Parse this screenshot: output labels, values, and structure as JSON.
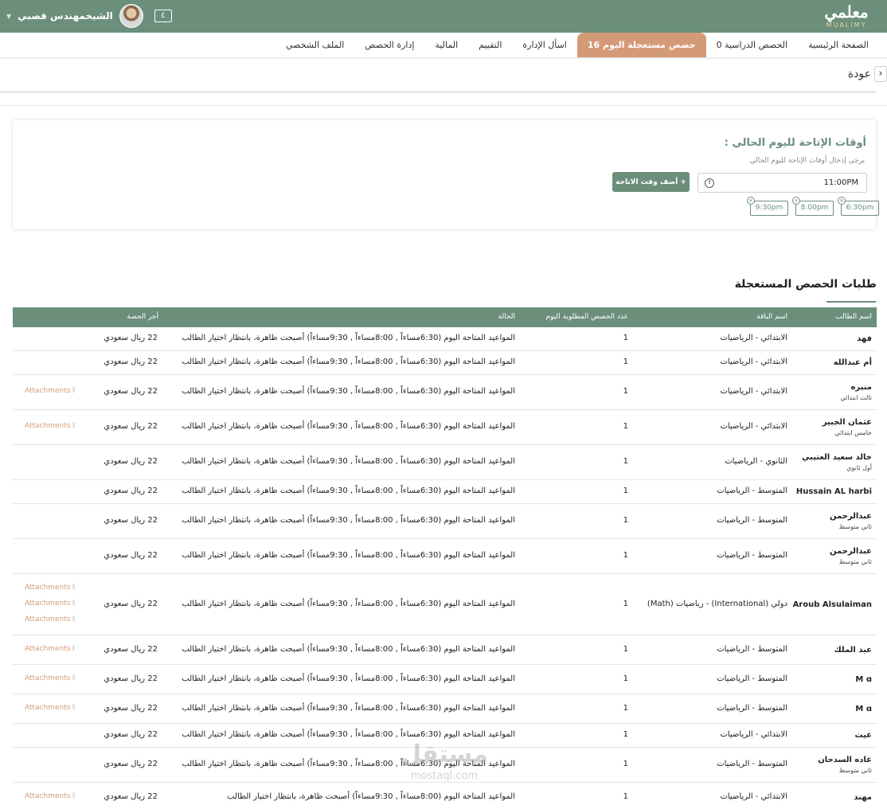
{
  "header": {
    "logo_ar": "معلمي",
    "logo_en": "MUALIMY",
    "user_name": "الشيخمهندس قصبي",
    "notifications": "٤"
  },
  "nav": {
    "tabs": [
      {
        "label": "الصفحة الرئيسية",
        "active": false
      },
      {
        "label": "الحصص الدراسية 0",
        "active": false
      },
      {
        "label": "حصص مستعجلة اليوم 16",
        "active": true
      },
      {
        "label": "اسأل الإدارة",
        "active": false
      },
      {
        "label": "التقييم",
        "active": false
      },
      {
        "label": "المالية",
        "active": false
      },
      {
        "label": "إدارة الحصص",
        "active": false
      },
      {
        "label": "الملف الشخصي",
        "active": false
      }
    ]
  },
  "back": {
    "label": "عودة"
  },
  "availability": {
    "title": "أوقات الإتاحة لليوم الحالي :",
    "subtitle": "يرجى إدخال أوقات الإتاحة لليوم الحالي",
    "time_value": "11:00PM",
    "add_button": "أضف وقت الاتاحة",
    "add_plus": "+",
    "chips": [
      "6:30pm",
      "8:00pm",
      "9:30pm"
    ]
  },
  "requests": {
    "title": "طلبات الحصص المستعجلة",
    "columns": {
      "student": "اسم الطالب",
      "package": "اسم الباقة",
      "count": "عدد الحصص المطلوبة اليوم",
      "status": "الحالة",
      "fee": "أجر الحصة"
    },
    "attachment_label": "Attachments",
    "rows": [
      {
        "name": "فهد",
        "grade": "",
        "package": "الابتدائي - الرياضيات",
        "count": "1",
        "status": "المواعيد المتاحة اليوم (6:30مساءاً , 8:00مساءاً , 9:30مساءاً) أصبحت ظاهرة، بانتظار اختيار الطالب",
        "fee": "22 ريال سعودي",
        "attachments": 0
      },
      {
        "name": "أم عبدالله",
        "grade": "",
        "package": "الابتدائي - الرياضيات",
        "count": "1",
        "status": "المواعيد المتاحة اليوم (6:30مساءاً , 8:00مساءاً , 9:30مساءاً) أصبحت ظاهرة، بانتظار اختيار الطالب",
        "fee": "22 ريال سعودي",
        "attachments": 0
      },
      {
        "name": "منيره",
        "grade": "ثالث ابتدائي",
        "package": "الابتدائي - الرياضيات",
        "count": "1",
        "status": "المواعيد المتاحة اليوم (6:30مساءاً , 8:00مساءاً , 9:30مساءاً) أصبحت ظاهرة، بانتظار اختيار الطالب",
        "fee": "22 ريال سعودي",
        "attachments": 1
      },
      {
        "name": "عثمان الجبير",
        "grade": "خامس ابتدائي",
        "package": "الابتدائي - الرياضيات",
        "count": "1",
        "status": "المواعيد المتاحة اليوم (6:30مساءاً , 8:00مساءاً , 9:30مساءاً) أصبحت ظاهرة، بانتظار اختيار الطالب",
        "fee": "22 ريال سعودي",
        "attachments": 1
      },
      {
        "name": "خالد سعيد العتيبي",
        "grade": "أول ثانوي",
        "package": "الثانوي - الرياضيات",
        "count": "1",
        "status": "المواعيد المتاحة اليوم (6:30مساءاً , 8:00مساءاً , 9:30مساءاً) أصبحت ظاهرة، بانتظار اختيار الطالب",
        "fee": "22 ريال سعودي",
        "attachments": 0
      },
      {
        "name": "Hussain AL harbi",
        "grade": "",
        "package": "المتوسط - الرياضيات",
        "count": "1",
        "status": "المواعيد المتاحة اليوم (6:30مساءاً , 8:00مساءاً , 9:30مساءاً) أصبحت ظاهرة، بانتظار اختيار الطالب",
        "fee": "22 ريال سعودي",
        "attachments": 0
      },
      {
        "name": "عبدالرحمن",
        "grade": "ثاني متوسط",
        "package": "المتوسط - الرياضيات",
        "count": "1",
        "status": "المواعيد المتاحة اليوم (6:30مساءاً , 8:00مساءاً , 9:30مساءاً) أصبحت ظاهرة، بانتظار اختيار الطالب",
        "fee": "22 ريال سعودي",
        "attachments": 0
      },
      {
        "name": "عبدالرحمن",
        "grade": "ثاني متوسط",
        "package": "المتوسط - الرياضيات",
        "count": "1",
        "status": "المواعيد المتاحة اليوم (6:30مساءاً , 8:00مساءاً , 9:30مساءاً) أصبحت ظاهرة، بانتظار اختيار الطالب",
        "fee": "22 ريال سعودي",
        "attachments": 0
      },
      {
        "name": "Aroub Alsulaiman",
        "grade": "",
        "package": "دولي (International) - رياضيات (Math)",
        "count": "1",
        "status": "المواعيد المتاحة اليوم (6:30مساءاً , 8:00مساءاً , 9:30مساءاً) أصبحت ظاهرة، بانتظار اختيار الطالب",
        "fee": "22 ريال سعودي",
        "attachments": 3
      },
      {
        "name": "عبد الملك",
        "grade": "",
        "package": "المتوسط - الرياضيات",
        "count": "1",
        "status": "المواعيد المتاحة اليوم (6:30مساءاً , 8:00مساءاً , 9:30مساءاً) أصبحت ظاهرة، بانتظار اختيار الطالب",
        "fee": "22 ريال سعودي",
        "attachments": 1
      },
      {
        "name": "M ɑ",
        "grade": "",
        "package": "المتوسط - الرياضيات",
        "count": "1",
        "status": "المواعيد المتاحة اليوم (6:30مساءاً , 8:00مساءاً , 9:30مساءاً) أصبحت ظاهرة، بانتظار اختيار الطالب",
        "fee": "22 ريال سعودي",
        "attachments": 1
      },
      {
        "name": "M ɑ",
        "grade": "",
        "package": "المتوسط - الرياضيات",
        "count": "1",
        "status": "المواعيد المتاحة اليوم (6:30مساءاً , 8:00مساءاً , 9:30مساءاً) أصبحت ظاهرة، بانتظار اختيار الطالب",
        "fee": "22 ريال سعودي",
        "attachments": 1
      },
      {
        "name": "غيث",
        "grade": "",
        "package": "الابتدائي - الرياضيات",
        "count": "1",
        "status": "المواعيد المتاحة اليوم (6:30مساءاً , 8:00مساءاً , 9:30مساءاً) أصبحت ظاهرة، بانتظار اختيار الطالب",
        "fee": "22 ريال سعودي",
        "attachments": 0
      },
      {
        "name": "غاده السدحان",
        "grade": "ثاني متوسط",
        "package": "المتوسط - الرياضيات",
        "count": "1",
        "status": "المواعيد المتاحة اليوم (6:30مساءاً , 8:00مساءاً , 9:30مساءاً) أصبحت ظاهرة، بانتظار اختيار الطالب",
        "fee": "22 ريال سعودي",
        "attachments": 0
      },
      {
        "name": "مهند",
        "grade": "",
        "package": "الابتدائي - الرياضيات",
        "count": "1",
        "status": "المواعيد المتاحة اليوم (8:00مساءاً , 9:30مساءاً) أصبحت ظاهرة، بانتظار اختيار الطالب",
        "fee": "22 ريال سعودي",
        "attachments": 1
      }
    ]
  },
  "watermark": {
    "ar": "مستقل",
    "en": "mostaql.com"
  },
  "colors": {
    "primary": "#6b8f7b",
    "accent": "#d49a78"
  }
}
